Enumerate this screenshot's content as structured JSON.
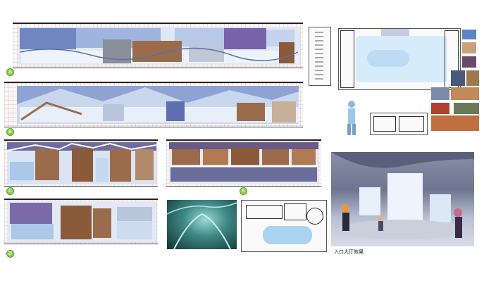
{
  "elevations": [
    {
      "id": "A",
      "label": "A"
    },
    {
      "id": "B",
      "label": "B"
    },
    {
      "id": "C",
      "label": "C"
    },
    {
      "id": "D",
      "label": "D"
    },
    {
      "id": "E",
      "label": "E"
    }
  ],
  "render_caption": "入口大厅效果",
  "colors": {
    "accent": "#8fd14f",
    "ice": "#a9c8ea",
    "wood": "#8a5a3a",
    "stone": "#8a8f99",
    "sky": "#5d6fb0"
  }
}
